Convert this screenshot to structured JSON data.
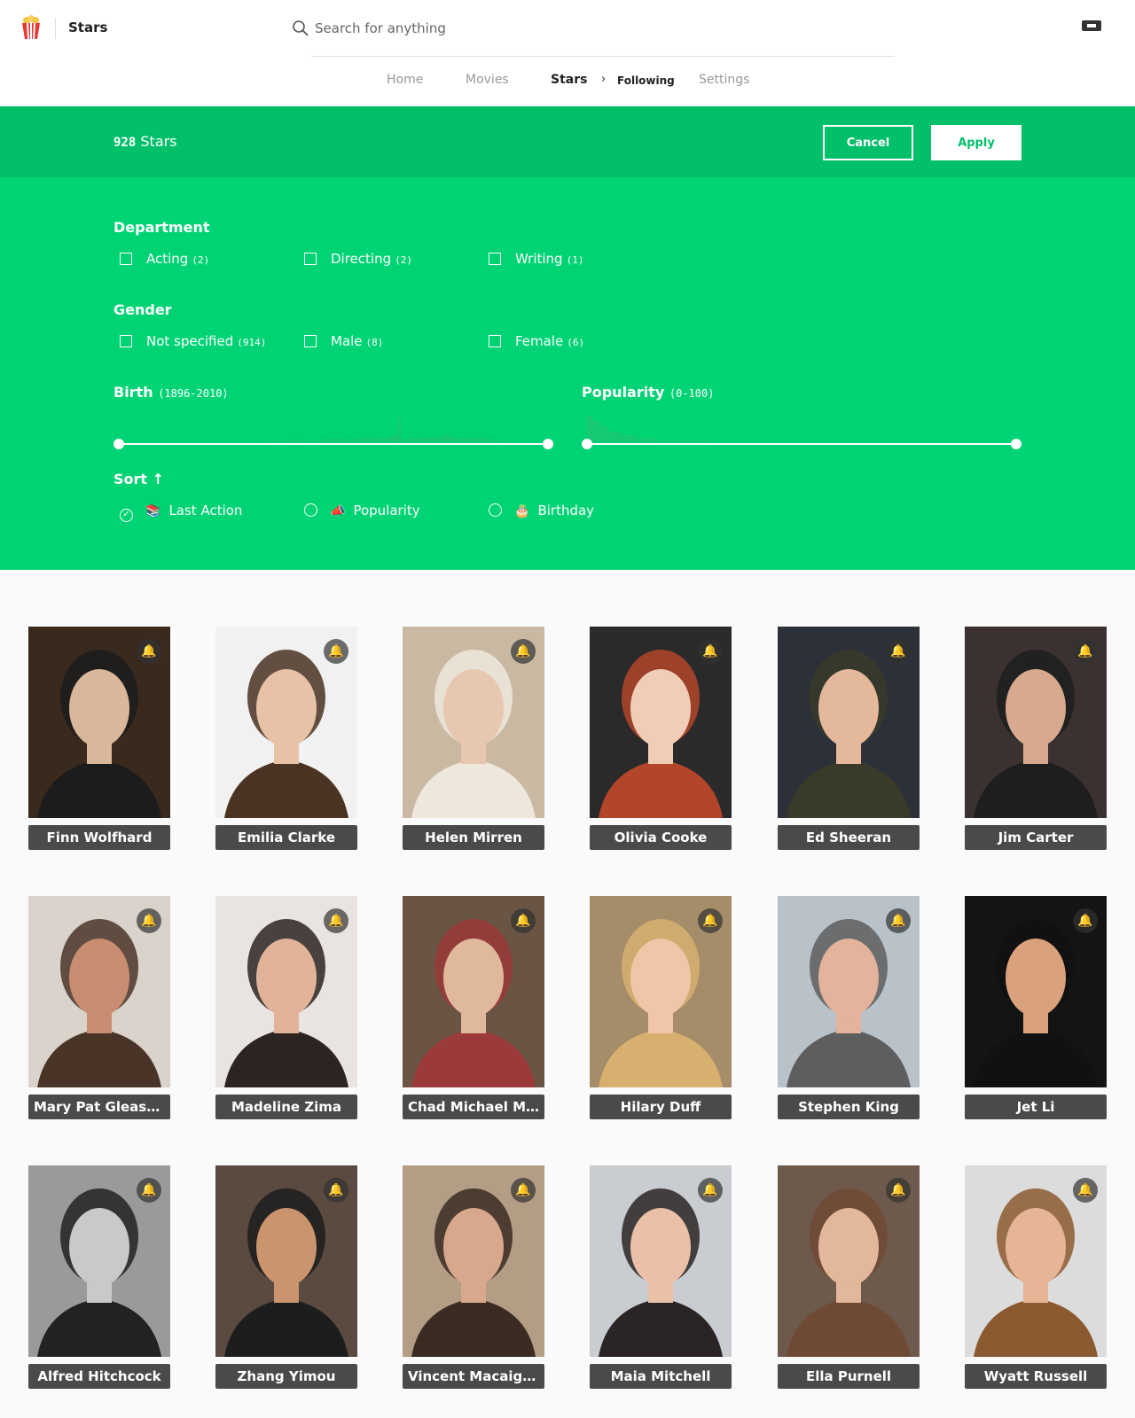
{
  "header": {
    "brand": "Stars",
    "search_placeholder": "Search for anything",
    "nav": [
      {
        "label": "Home"
      },
      {
        "label": "Movies"
      },
      {
        "label": "Stars"
      },
      {
        "label": "Following"
      },
      {
        "label": "Settings"
      }
    ],
    "nav_chevron": "›"
  },
  "toolbar": {
    "count_number": "928",
    "count_label": "Stars",
    "cancel_label": "Cancel",
    "apply_label": "Apply"
  },
  "filters": {
    "department": {
      "title": "Department",
      "options": [
        {
          "label": "Acting",
          "count": "(2)"
        },
        {
          "label": "Directing",
          "count": "(2)"
        },
        {
          "label": "Writing",
          "count": "(1)"
        }
      ]
    },
    "gender": {
      "title": "Gender",
      "options": [
        {
          "label": "Not specified",
          "count": "(914)"
        },
        {
          "label": "Male",
          "count": "(8)"
        },
        {
          "label": "Female",
          "count": "(6)"
        }
      ]
    },
    "birth": {
      "title": "Birth",
      "range": "(1896-2010)"
    },
    "popularity": {
      "title": "Popularity",
      "range": "(0-100)"
    },
    "sort": {
      "title": "Sort",
      "arrow": "↑",
      "options": [
        {
          "label": "Last Action",
          "emoji": "📚",
          "selected": true
        },
        {
          "label": "Popularity",
          "emoji": "📣",
          "selected": false
        },
        {
          "label": "Birthday",
          "emoji": "🎂",
          "selected": false
        }
      ]
    }
  },
  "stars": [
    {
      "name": "Finn Wolfhard"
    },
    {
      "name": "Emilia Clarke"
    },
    {
      "name": "Helen Mirren"
    },
    {
      "name": "Olivia Cooke"
    },
    {
      "name": "Ed Sheeran"
    },
    {
      "name": "Jim Carter"
    },
    {
      "name": "Mary Pat Gleason"
    },
    {
      "name": "Madeline Zima"
    },
    {
      "name": "Chad Michael Mu..."
    },
    {
      "name": "Hilary Duff"
    },
    {
      "name": "Stephen King"
    },
    {
      "name": "Jet Li"
    },
    {
      "name": "Alfred Hitchcock"
    },
    {
      "name": "Zhang Yimou"
    },
    {
      "name": "Vincent Macaigne"
    },
    {
      "name": "Maia Mitchell"
    },
    {
      "name": "Ella Purnell"
    },
    {
      "name": "Wyatt Russell"
    }
  ],
  "bell_icon": "🔔",
  "colors": {
    "accent_dark": "#02bf6a",
    "accent": "#00d374",
    "name_bar": "#4a4a4a",
    "bell": "#f4c400"
  }
}
